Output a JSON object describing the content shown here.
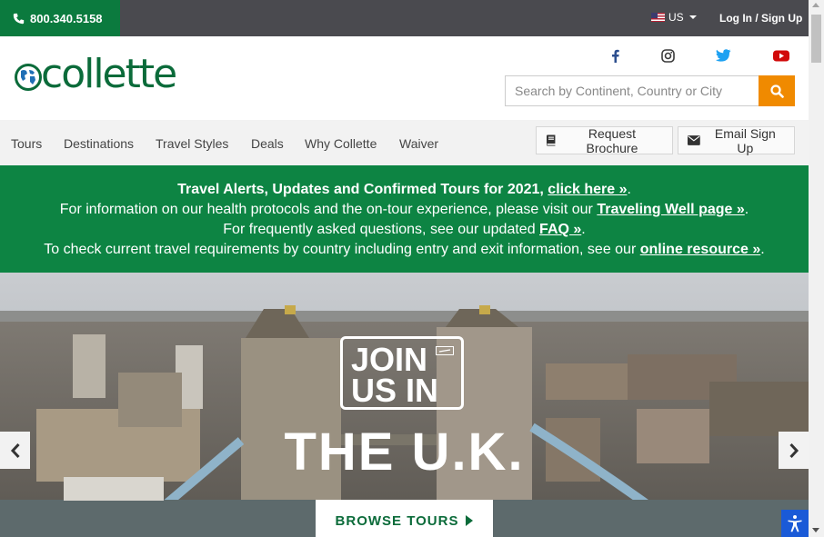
{
  "topbar": {
    "phone": "800.340.5158",
    "locale": "US",
    "login": "Log In / Sign Up"
  },
  "header": {
    "logo_text": "collette",
    "social": [
      "facebook-icon",
      "instagram-icon",
      "twitter-icon",
      "youtube-icon"
    ],
    "search_placeholder": "Search by Continent, Country or City"
  },
  "nav": {
    "items": [
      "Tours",
      "Destinations",
      "Travel Styles",
      "Deals",
      "Why Collette",
      "Waiver"
    ],
    "request_brochure": "Request Brochure",
    "email_signup": "Email Sign Up"
  },
  "alert": {
    "line1_text": "Travel Alerts, Updates and Confirmed Tours for 2021, ",
    "line1_link": "click here »",
    "line1_end": ".",
    "line2_text": "For information on our health protocols and the on-tour experience, please visit our ",
    "line2_link": "Traveling Well page »",
    "line2_end": ".",
    "line3_text": "For frequently asked questions, see our updated ",
    "line3_link": "FAQ »",
    "line3_end": ".",
    "line4_text": "To check current travel requirements by country including entry and exit information, see our ",
    "line4_link": "online resource »",
    "line4_end": "."
  },
  "hero": {
    "join_line1": "JOIN",
    "join_line2": "US IN",
    "headline": "THE U.K.",
    "cta": "BROWSE TOURS"
  },
  "colors": {
    "brand_green": "#0b6b3a",
    "alert_green": "#0d8443",
    "topbar_gray": "#4a4a4f",
    "search_orange": "#f08a00",
    "accessibility_blue": "#1a5ad7"
  }
}
